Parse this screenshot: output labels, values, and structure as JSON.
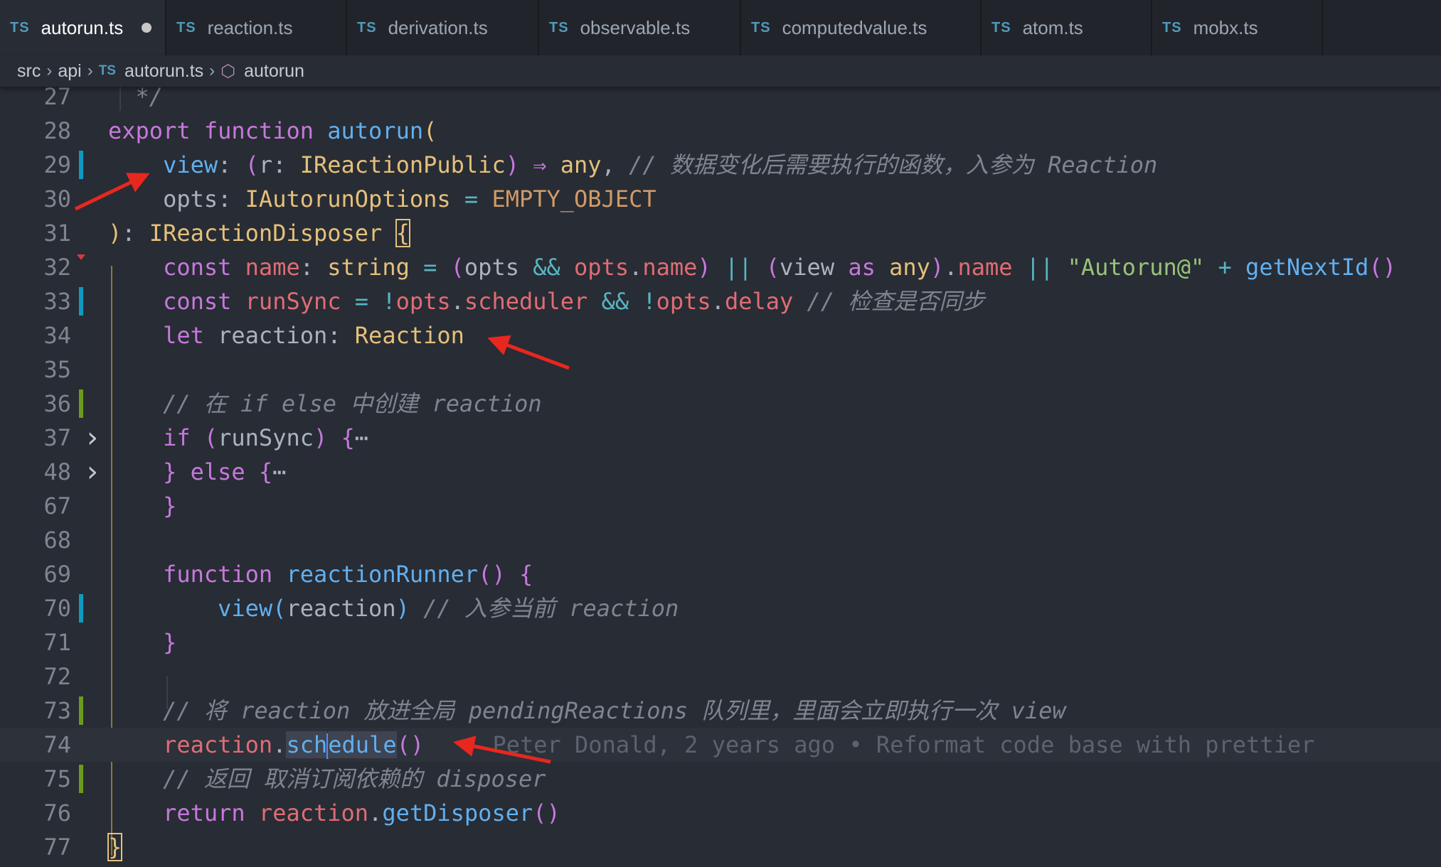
{
  "tabs": [
    {
      "label": "autorun.ts",
      "icon": "TS",
      "active": true,
      "dirty": true
    },
    {
      "label": "reaction.ts",
      "icon": "TS"
    },
    {
      "label": "derivation.ts",
      "icon": "TS"
    },
    {
      "label": "observable.ts",
      "icon": "TS"
    },
    {
      "label": "computedvalue.ts",
      "icon": "TS"
    },
    {
      "label": "atom.ts",
      "icon": "TS"
    },
    {
      "label": "mobx.ts",
      "icon": "TS"
    }
  ],
  "breadcrumb": {
    "items": [
      "src",
      "api",
      "autorun.ts",
      "autorun"
    ],
    "file_icon": "TS",
    "symbol_icon": "cube-icon"
  },
  "editor": {
    "lines": [
      {
        "n": "27",
        "tokens": [
          [
            "co",
            "  */"
          ]
        ]
      },
      {
        "n": "28",
        "tokens": [
          [
            "kw",
            "export "
          ],
          [
            "kw",
            "function "
          ],
          [
            "fn",
            "autorun"
          ],
          [
            "br1",
            "("
          ]
        ]
      },
      {
        "n": "29",
        "gutter": "modified",
        "tokens": [
          [
            "pl",
            "    "
          ],
          [
            "fn",
            "view"
          ],
          [
            "pl",
            ": "
          ],
          [
            "br2",
            "("
          ],
          [
            "pl",
            "r: "
          ],
          [
            "ty",
            "IReactionPublic"
          ],
          [
            "br2",
            ")"
          ],
          [
            "pl",
            " "
          ],
          [
            "kw",
            "⇒"
          ],
          [
            "pl",
            " "
          ],
          [
            "ty",
            "any"
          ],
          [
            "pl",
            ", "
          ],
          [
            "co",
            "// 数据变化后需要执行的函数，入参为 Reaction"
          ]
        ]
      },
      {
        "n": "30",
        "tokens": [
          [
            "pl",
            "    opts: "
          ],
          [
            "ty",
            "IAutorunOptions"
          ],
          [
            "pl",
            " "
          ],
          [
            "op",
            "="
          ],
          [
            "pl",
            " "
          ],
          [
            "cn",
            "EMPTY_OBJECT"
          ]
        ]
      },
      {
        "n": "31",
        "tokens": [
          [
            "br1",
            ")"
          ],
          [
            "pl",
            ": "
          ],
          [
            "ty",
            "IReactionDisposer"
          ],
          [
            "pl",
            " "
          ],
          [
            "br1box",
            "{"
          ]
        ]
      },
      {
        "n": "32",
        "error": true,
        "tokens": [
          [
            "pl",
            "    "
          ],
          [
            "kw",
            "const "
          ],
          [
            "va",
            "name"
          ],
          [
            "pl",
            ": "
          ],
          [
            "ty",
            "string"
          ],
          [
            "pl",
            " "
          ],
          [
            "op",
            "="
          ],
          [
            "pl",
            " "
          ],
          [
            "br2",
            "("
          ],
          [
            "pl",
            "opts "
          ],
          [
            "op",
            "&&"
          ],
          [
            "pl",
            " "
          ],
          [
            "va",
            "opts"
          ],
          [
            "pl",
            "."
          ],
          [
            "va",
            "name"
          ],
          [
            "br2",
            ")"
          ],
          [
            "pl",
            " "
          ],
          [
            "op",
            "||"
          ],
          [
            "pl",
            " "
          ],
          [
            "br2",
            "("
          ],
          [
            "pl",
            "view "
          ],
          [
            "kw",
            "as "
          ],
          [
            "ty",
            "any"
          ],
          [
            "br2",
            ")"
          ],
          [
            "pl",
            "."
          ],
          [
            "va",
            "name"
          ],
          [
            "pl",
            " "
          ],
          [
            "op",
            "||"
          ],
          [
            "pl",
            " "
          ],
          [
            "st",
            "\"Autorun@\""
          ],
          [
            "pl",
            " "
          ],
          [
            "op",
            "+"
          ],
          [
            "pl",
            " "
          ],
          [
            "fn",
            "getNextId"
          ],
          [
            "br2",
            "()"
          ]
        ]
      },
      {
        "n": "33",
        "gutter": "modified",
        "tokens": [
          [
            "pl",
            "    "
          ],
          [
            "kw",
            "const "
          ],
          [
            "va",
            "runSync"
          ],
          [
            "pl",
            " "
          ],
          [
            "op",
            "="
          ],
          [
            "pl",
            " "
          ],
          [
            "op",
            "!"
          ],
          [
            "va",
            "opts"
          ],
          [
            "pl",
            "."
          ],
          [
            "va",
            "scheduler"
          ],
          [
            "pl",
            " "
          ],
          [
            "op",
            "&&"
          ],
          [
            "pl",
            " "
          ],
          [
            "op",
            "!"
          ],
          [
            "va",
            "opts"
          ],
          [
            "pl",
            "."
          ],
          [
            "va",
            "delay"
          ],
          [
            "pl",
            " "
          ],
          [
            "co",
            "// 检查是否同步"
          ]
        ]
      },
      {
        "n": "34",
        "tokens": [
          [
            "pl",
            "    "
          ],
          [
            "kw",
            "let "
          ],
          [
            "pl",
            "reaction: "
          ],
          [
            "ty",
            "Reaction"
          ]
        ]
      },
      {
        "n": "35",
        "tokens": []
      },
      {
        "n": "36",
        "gutter": "added",
        "tokens": [
          [
            "pl",
            "    "
          ],
          [
            "co",
            "// 在 if else 中创建 reaction"
          ]
        ]
      },
      {
        "n": "37",
        "fold": true,
        "tokens": [
          [
            "pl",
            "    "
          ],
          [
            "kw",
            "if "
          ],
          [
            "br2",
            "("
          ],
          [
            "pl",
            "runSync"
          ],
          [
            "br2",
            ")"
          ],
          [
            "pl",
            " "
          ],
          [
            "br2",
            "{"
          ],
          [
            "pl",
            "⋯"
          ]
        ]
      },
      {
        "n": "48",
        "fold": true,
        "tokens": [
          [
            "pl",
            "    "
          ],
          [
            "br2",
            "}"
          ],
          [
            "pl",
            " "
          ],
          [
            "kw",
            "else "
          ],
          [
            "br2",
            "{"
          ],
          [
            "pl",
            "⋯"
          ]
        ]
      },
      {
        "n": "67",
        "tokens": [
          [
            "pl",
            "    "
          ],
          [
            "br2",
            "}"
          ]
        ]
      },
      {
        "n": "68",
        "tokens": []
      },
      {
        "n": "69",
        "tokens": [
          [
            "pl",
            "    "
          ],
          [
            "kw",
            "function "
          ],
          [
            "fn",
            "reactionRunner"
          ],
          [
            "br2",
            "()"
          ],
          [
            "pl",
            " "
          ],
          [
            "br2",
            "{"
          ]
        ]
      },
      {
        "n": "70",
        "gutter": "modified",
        "tokens": [
          [
            "pl",
            "        "
          ],
          [
            "fn",
            "view"
          ],
          [
            "br3",
            "("
          ],
          [
            "pl",
            "reaction"
          ],
          [
            "br3",
            ")"
          ],
          [
            "pl",
            " "
          ],
          [
            "co",
            "// 入参当前 reaction"
          ]
        ]
      },
      {
        "n": "71",
        "tokens": [
          [
            "pl",
            "    "
          ],
          [
            "br2",
            "}"
          ]
        ]
      },
      {
        "n": "72",
        "tokens": []
      },
      {
        "n": "73",
        "gutter": "added",
        "tokens": [
          [
            "pl",
            "    "
          ],
          [
            "co",
            "// 将 reaction 放进全局 pendingReactions 队列里，里面会立即执行一次 view"
          ]
        ]
      },
      {
        "n": "74",
        "highlight": true,
        "tokens": [
          [
            "pl",
            "    "
          ],
          [
            "va",
            "reaction"
          ],
          [
            "pl",
            "."
          ],
          [
            "selfn1",
            "sch"
          ],
          [
            "cursor",
            ""
          ],
          [
            "selfn2",
            "edule"
          ],
          [
            "br2",
            "()"
          ],
          [
            "pl",
            "     "
          ],
          [
            "blame",
            "Peter Donald, 2 years ago • Reformat code base with prettier"
          ]
        ]
      },
      {
        "n": "75",
        "gutter": "added",
        "tokens": [
          [
            "pl",
            "    "
          ],
          [
            "co",
            "// 返回 取消订阅依赖的 disposer"
          ]
        ]
      },
      {
        "n": "76",
        "tokens": [
          [
            "pl",
            "    "
          ],
          [
            "kw",
            "return "
          ],
          [
            "va",
            "reaction"
          ],
          [
            "pl",
            "."
          ],
          [
            "fn",
            "getDisposer"
          ],
          [
            "br2",
            "()"
          ]
        ]
      },
      {
        "n": "77",
        "tokens": [
          [
            "br1box",
            "}"
          ]
        ]
      }
    ]
  },
  "colors": {
    "editor_bg": "#282c34",
    "tabbar_bg": "#21252b",
    "accent": "#519aba",
    "annotation_arrow": "#e8271f"
  }
}
